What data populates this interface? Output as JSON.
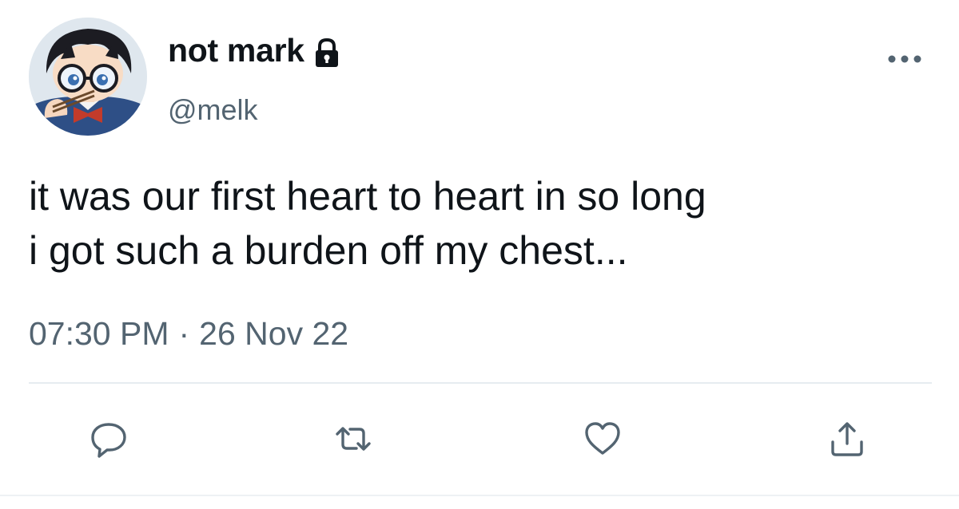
{
  "author": {
    "display_name": "not mark",
    "handle": "@melk",
    "protected_icon": "lock-icon",
    "avatar": "anime-character-avatar"
  },
  "tweet": {
    "text": "it was our first heart to heart in so long\ni got such a burden off my chest...",
    "time": "07:30 PM",
    "separator": "·",
    "date": "26 Nov 22"
  },
  "actions": {
    "reply_icon": "reply-icon",
    "retweet_icon": "retweet-icon",
    "like_icon": "heart-icon",
    "share_icon": "share-icon",
    "more_icon": "more-icon"
  },
  "colors": {
    "text_primary": "#0f1419",
    "text_secondary": "#536471",
    "icon": "#536471",
    "divider": "#e6ecf0"
  }
}
